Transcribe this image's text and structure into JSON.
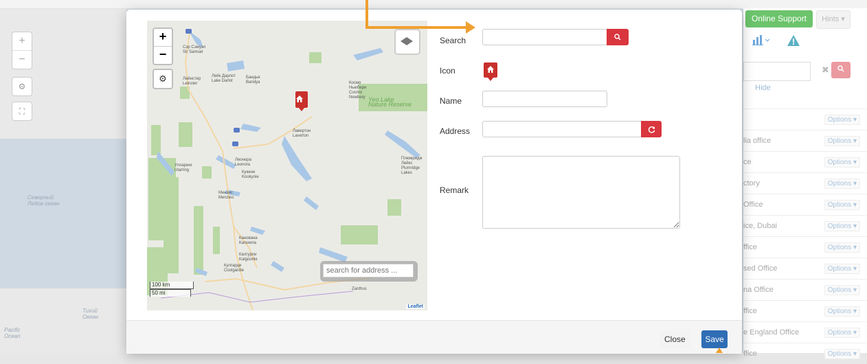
{
  "background": {
    "topbar_buttons": {
      "online_support": "Online Support",
      "hints": "Hints ▾"
    },
    "map_controls": {
      "zoom_in": "+",
      "zoom_out": "−",
      "gear": "⚙",
      "fullscreen": "⛶"
    },
    "map_labels": [
      "Северный\nЛедов океан",
      "Тихий\nОкеан",
      "Pacific\nOcean"
    ],
    "right_panel": {
      "chart_icon": "chart-icon",
      "warning_icon": "warning-icon",
      "search_placeholder": "",
      "clear_label": "✖",
      "search_button": "🔍",
      "hide_label": "Hide",
      "rows": [
        {
          "name": "",
          "options": "Options ▾"
        },
        {
          "name": "lia office",
          "options": "Options ▾"
        },
        {
          "name": "ce",
          "options": "Options ▾"
        },
        {
          "name": "ctory",
          "options": "Options ▾"
        },
        {
          "name": "Office",
          "options": "Options ▾"
        },
        {
          "name": "ice, Dubai",
          "options": "Options ▾"
        },
        {
          "name": "ffice",
          "options": "Options ▾"
        },
        {
          "name": "sed Office",
          "options": "Options ▾"
        },
        {
          "name": "na Office",
          "options": "Options ▾"
        },
        {
          "name": "ffice",
          "options": "Options ▾"
        },
        {
          "name": "e England Office",
          "options": "Options ▾"
        },
        {
          "name": "ffice",
          "options": "Options ▾"
        }
      ]
    }
  },
  "modal": {
    "map": {
      "zoom_in": "+",
      "zoom_out": "−",
      "settings": "⚙",
      "search_placeholder": "search for address ...",
      "scale_km": "100 km",
      "scale_mi": "50 mi",
      "attribution": "Leaflet",
      "places": [
        "Сэр Сэмуэл\nSir Samuel",
        "Лейнстер\nLeinster",
        "Лейк Дарлот\nLake Darlot",
        "Бандья\nBandya",
        "Космо\nНьюбери\nCosmo\nNewbery",
        "Yeo Lake\nNature Reserve",
        "Лавертон\nLaverton",
        "Леонора\nLeonora",
        "Кукини\nKookynie",
        "Улларинг\nUlarring",
        "Мензис\nMenzies",
        "Плюмридж\nЛейкс\nPlumridge\nLakes",
        "Канована\nKanowna",
        "Калгурли\nKalgoorlie",
        "Кулгарди\nCoolgardie",
        "Zanthus"
      ]
    },
    "form": {
      "search_label": "Search",
      "search_value": "",
      "search_button_icon": "search-icon",
      "icon_label": "Icon",
      "name_label": "Name",
      "name_value": "",
      "address_label": "Address",
      "address_value": "",
      "address_button_icon": "refresh-icon",
      "remark_label": "Remark",
      "remark_value": ""
    },
    "footer": {
      "close": "Close",
      "save": "Save"
    }
  },
  "colors": {
    "accent": "#2f6db5",
    "danger": "#d9363e",
    "success": "#6cc46c",
    "annotation": "#f0a030"
  }
}
